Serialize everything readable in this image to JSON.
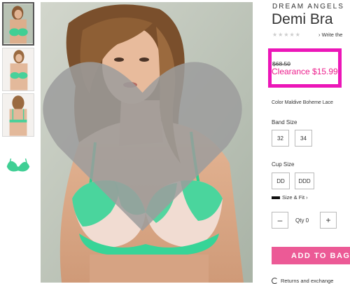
{
  "product": {
    "collection": "DREAM ANGELS",
    "name": "Demi Bra",
    "rating_stars": "★★★★★",
    "write_review": "Write the"
  },
  "price": {
    "original": "$68.50",
    "sale": "Clearance $15.99",
    "highlight_color": "#ec16b8",
    "sale_color": "#ec1e8c"
  },
  "color": {
    "label": "Color Maldive Boheme Lace"
  },
  "band_size": {
    "label": "Band Size",
    "options": [
      "32",
      "34"
    ]
  },
  "cup_size": {
    "label": "Cup Size",
    "options": [
      "DD",
      "DDD"
    ]
  },
  "size_fit": {
    "label": "Size & Fit ›",
    "icon": "ruler-icon"
  },
  "quantity": {
    "minus": "–",
    "label": "Qty 0",
    "plus": "+"
  },
  "cart": {
    "add_label": "ADD TO BAG",
    "button_color": "#ec5a96"
  },
  "returns": {
    "label": "Returns and exchange",
    "icon": "returns-icon"
  },
  "gallery": {
    "thumbnails": [
      "front-view",
      "side-view",
      "back-view",
      "product-only"
    ],
    "selected": 0,
    "favorite_icon": "heart-icon"
  }
}
